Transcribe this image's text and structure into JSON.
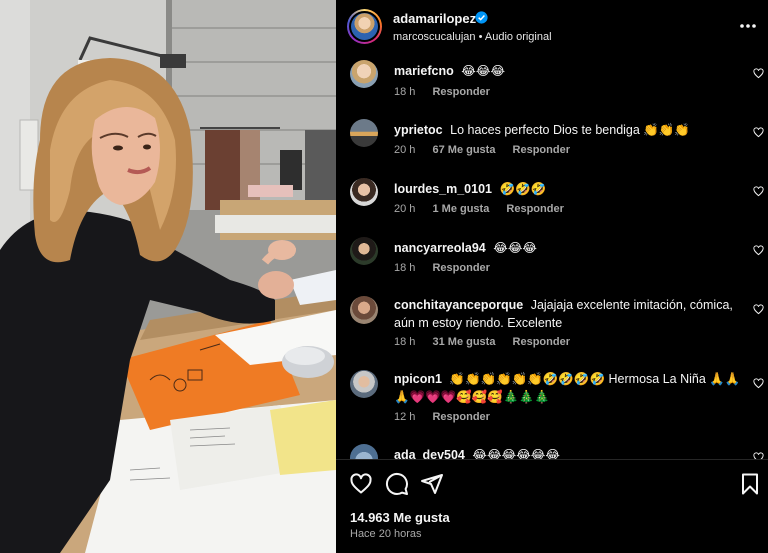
{
  "post": {
    "author": "adamarilopez",
    "subline": "marcoscucalujan • Audio original",
    "likes_label": "14.963 Me gusta",
    "time_ago": "Hace 20 horas"
  },
  "icons": {
    "verified": "verified-badge-icon",
    "more": "more-options-icon",
    "like": "heart-icon",
    "comment": "comment-bubble-icon",
    "share": "paper-plane-icon",
    "save": "bookmark-icon"
  },
  "colors": {
    "verified": "#0095f6",
    "meta": "#a8a8a8",
    "background": "#000000"
  },
  "comments": [
    {
      "user": "mariefcno",
      "text": "😂😂😂",
      "time": "18 h",
      "likes": "",
      "reply": "Responder"
    },
    {
      "user": "yprietoc",
      "text": "Lo haces perfecto Dios te bendiga 👏👏👏",
      "time": "20 h",
      "likes": "67 Me gusta",
      "reply": "Responder"
    },
    {
      "user": "lourdes_m_0101",
      "text": "🤣🤣🤣",
      "time": "20 h",
      "likes": "1 Me gusta",
      "reply": "Responder"
    },
    {
      "user": "nancyarreola94",
      "text": "😂😂😂",
      "time": "18 h",
      "likes": "",
      "reply": "Responder"
    },
    {
      "user": "conchitayanceporque",
      "text": "Jajajaja excelente imitación, cómica, aún m estoy riendo. Excelente",
      "time": "18 h",
      "likes": "31 Me gusta",
      "reply": "Responder"
    },
    {
      "user": "npicon1",
      "text": "👏👏👏👏👏👏🤣🤣🤣🤣 Hermosa La Niña 🙏🙏🙏💗💗💗🥰🥰🥰🎄🎄🎄",
      "time": "12 h",
      "likes": "",
      "reply": "Responder"
    },
    {
      "user": "ada_dev504",
      "text": "😂😂😂😂😂😂",
      "time": "",
      "likes": "",
      "reply": ""
    }
  ]
}
